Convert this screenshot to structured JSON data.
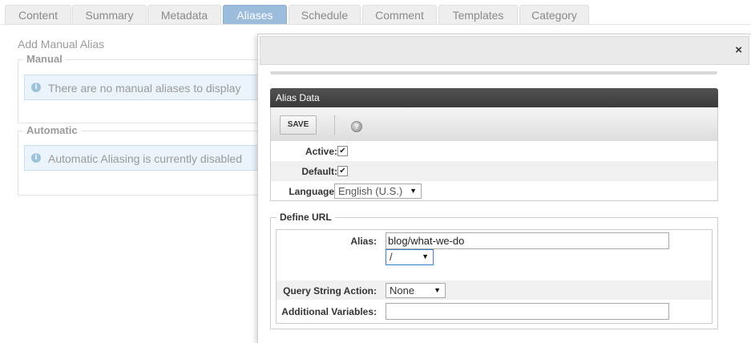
{
  "tabs": [
    {
      "label": "Content",
      "active": false
    },
    {
      "label": "Summary",
      "active": false
    },
    {
      "label": "Metadata",
      "active": false
    },
    {
      "label": "Aliases",
      "active": true
    },
    {
      "label": "Schedule",
      "active": false
    },
    {
      "label": "Comment",
      "active": false
    },
    {
      "label": "Templates",
      "active": false
    },
    {
      "label": "Category",
      "active": false
    }
  ],
  "background": {
    "add_manual_alias": "Add Manual Alias",
    "manual": {
      "legend": "Manual",
      "info": "There are no manual aliases to display"
    },
    "automatic": {
      "legend": "Automatic",
      "info": "Automatic Aliasing is currently disabled"
    }
  },
  "modal": {
    "close": "×",
    "panel_title": "Alias Data",
    "toolbar": {
      "save_label": "SAVE",
      "help": "?"
    },
    "fields": {
      "active": {
        "label": "Active:",
        "checked": true,
        "mark": "✔"
      },
      "default": {
        "label": "Default:",
        "checked": true,
        "mark": "✔"
      },
      "language": {
        "label": "Language:",
        "value": "English (U.S.)"
      }
    },
    "define_url": {
      "legend": "Define URL",
      "alias": {
        "label": "Alias:",
        "value": "blog/what-we-do",
        "separator": "/"
      },
      "query_string_action": {
        "label": "Query String Action:",
        "value": "None"
      },
      "additional_variables": {
        "label": "Additional Variables:",
        "value": ""
      }
    }
  },
  "icons": {
    "info": "info-icon",
    "close": "close-icon",
    "help": "help-icon",
    "dropdown": "chevron-down-icon"
  },
  "colors": {
    "active_tab": "#9cbcdc",
    "info_bg": "#eaf4fa",
    "panel_title": "#444444"
  }
}
